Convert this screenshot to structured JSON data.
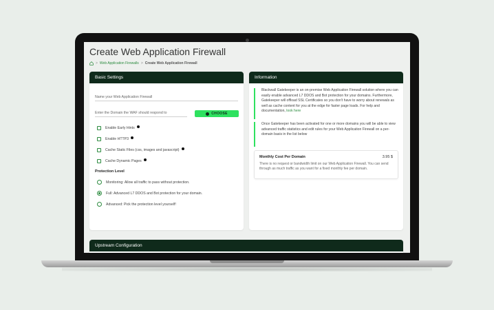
{
  "page": {
    "title": "Create Web Application Firewall",
    "breadcrumb": {
      "parent": "Web Application Firewalls",
      "separator": ">",
      "current": "Create Web Application Firewall"
    }
  },
  "basic": {
    "header": "Basic Settings",
    "name_placeholder": "Name your Web Application Firewall",
    "domain_placeholder": "Enter the Domain the WAF should respond to",
    "choose_label": "CHOOSE",
    "checkboxes": [
      {
        "label": "Enable Early Hints",
        "checked": false,
        "info": true
      },
      {
        "label": "Enable HTTP3",
        "checked": false,
        "info": true
      },
      {
        "label": "Cache Static Files (css, images and javascript)",
        "checked": false,
        "info": true
      },
      {
        "label": "Cache Dynamic Pages",
        "checked": false,
        "info": true
      }
    ],
    "protection_label": "Protection Level",
    "radios": [
      {
        "label": "Monitoring: Allow all traffic to pass without protection.",
        "selected": false
      },
      {
        "label": "Full: Advanced L7 DDOS and Bot protection for your domain.",
        "selected": true
      },
      {
        "label": "Advanced: Pick the protection level yourself!",
        "selected": false
      }
    ]
  },
  "info": {
    "header": "Information",
    "para1": "Blackwall Gatekeeper is an on-premise Web Application Firewall solution where you can easily enable advanced L7 DDOS and Bot protection for your domains. Furthermore, Gatekeeper will offload SSL Certificates so you don't have to worry about renewals as well as cache content for you at the edge for faster page loads. For help and documentation,",
    "para1_link": "look here",
    "para2": "Once Gatekeeper has been activated for one or more domains you will be able to view advanced traffic statistics and edit rules for your Web Application Firewall on a per-domain basis in the list below",
    "cost_label": "Monthly Cost Per Domain",
    "cost_value": "3.95 $",
    "cost_desc": "There is no request or bandwidth limit on our Web Application Firewall. You can send through as much traffic as you want for a fixed monthly fee per domain."
  },
  "upstream": {
    "header": "Upstream Configuration"
  },
  "colors": {
    "header_bg": "#0f2a1b",
    "accent": "#2ee15f",
    "link": "#2b8a3e"
  }
}
